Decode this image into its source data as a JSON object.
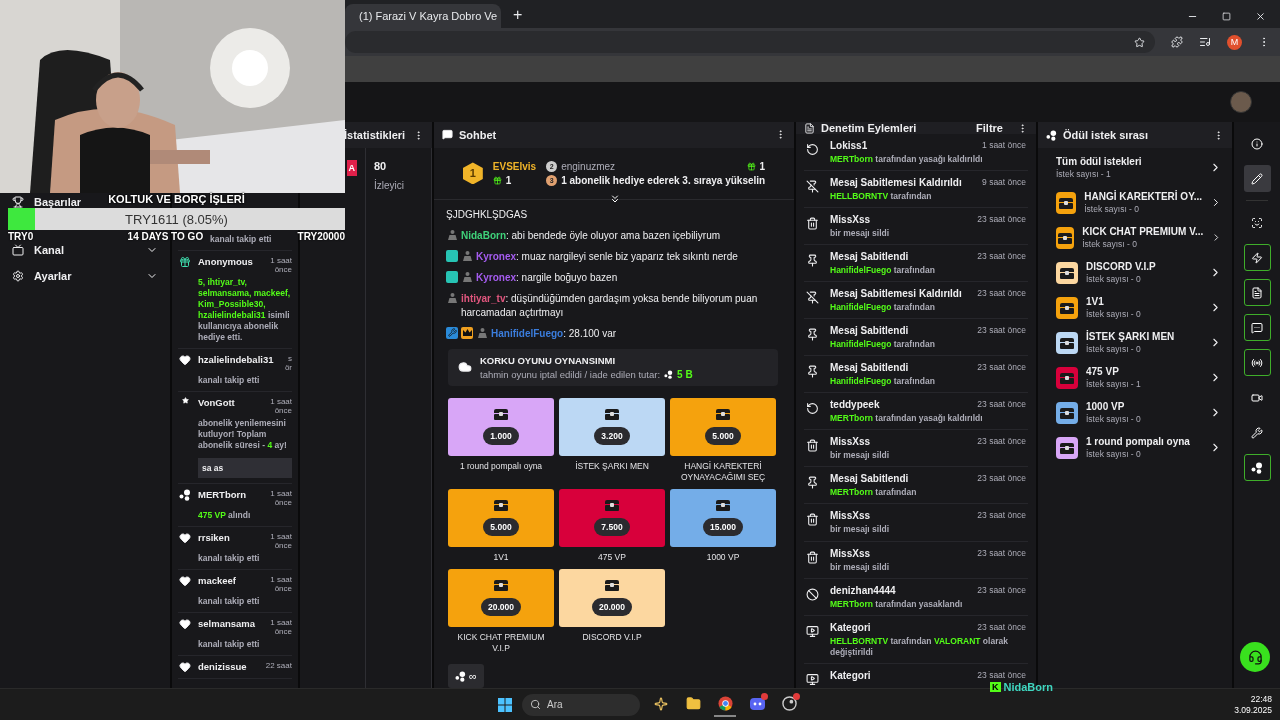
{
  "browser": {
    "tab_title": "(1) Farazi V Kayra Dobro Ve",
    "new_tab": "+",
    "profile_initial": "M"
  },
  "goal": {
    "title": "KOLTUK VE BORÇ İŞLERİ",
    "reading": "TRY1611 (8.05%)",
    "level": 0.0805,
    "start": "TRY0",
    "remaining": "14 DAYS TO GO",
    "target": "TRY20000"
  },
  "sidebar": {
    "items": [
      {
        "label": "Başarılar",
        "kind": "trophy"
      },
      {
        "label": "Kanal",
        "kind": "channel",
        "expanded": false
      },
      {
        "label": "Ayarlar",
        "kind": "settings",
        "expanded": false
      }
    ]
  },
  "activity": {
    "items": [
      {
        "kind": "tail",
        "parts": [
          {
            "text": "kanalı takip etti",
            "highlight": false
          }
        ]
      },
      {
        "kind": "gift",
        "user": "Anonymous",
        "time": "1 saat önce",
        "parts": [
          {
            "text": "5, ihtiyar_tv, selmansama, mackeef, Kim_Possible30, hzalielindebali31",
            "highlight": true
          },
          {
            "text": " isimli kullanıcıya abonelik hediye etti.",
            "highlight": false
          }
        ]
      },
      {
        "kind": "follow",
        "user": "hzalielindebali31",
        "time": "s ör",
        "parts": [
          {
            "text": "kanalı takip etti",
            "highlight": false
          }
        ]
      },
      {
        "kind": "resub",
        "user": "VonGott",
        "time": "1 saat önce",
        "parts": [
          {
            "text": "abonelik yenilemesini kutluyor! Toplam abonelik süresi - ",
            "highlight": false
          },
          {
            "text": "4",
            "highlight": true
          },
          {
            "text": " ay!",
            "highlight": false
          }
        ],
        "message": "sa as"
      },
      {
        "kind": "redeem",
        "user": "MERTborn",
        "time": "1 saat önce",
        "parts": [
          {
            "text": "475 VP",
            "highlight": true
          },
          {
            "text": " alındı",
            "highlight": false
          }
        ]
      },
      {
        "kind": "follow",
        "user": "rrsiken",
        "time": "1 saat önce",
        "parts": [
          {
            "text": "kanalı takip etti",
            "highlight": false
          }
        ]
      },
      {
        "kind": "follow",
        "user": "mackeef",
        "time": "1 saat önce",
        "parts": [
          {
            "text": "kanalı takip etti",
            "highlight": false
          }
        ]
      },
      {
        "kind": "follow",
        "user": "selmansama",
        "time": "1 saat önce",
        "parts": [
          {
            "text": "kanalı takip etti",
            "highlight": false
          }
        ]
      },
      {
        "kind": "follow",
        "user": "denizissue",
        "time": "22 saat"
      }
    ]
  },
  "stats": {
    "title": "İstatistikleri",
    "badge": "A",
    "viewers": "80",
    "viewers_label": "İzleyici"
  },
  "chat": {
    "title": "Sohbet",
    "leaders": [
      {
        "rank": "1",
        "name": "EVSElvis",
        "gifts": "1"
      },
      {
        "rank": "2",
        "name": "enginuzmez",
        "gifts": "1"
      },
      {
        "rank": "3",
        "name": "1 abonelik hediye ederek 3. sıraya yükselin"
      }
    ],
    "messages": [
      {
        "kind": "continuation",
        "text": "ŞJDGHKLŞDGAS"
      },
      {
        "kind": "message",
        "user": "NidaBorn",
        "color": "#3fd27a",
        "badges": [
          {
            "kind": "figure"
          }
        ],
        "text": "abi bendede öyle oluyor ama bazen içebiliyrum"
      },
      {
        "kind": "message",
        "user": "Kyronex",
        "color": "#a55cf0",
        "badges": [
          {
            "kind": "sub"
          },
          {
            "kind": "figure"
          }
        ],
        "text": "muaz nargileyi senle biz yaparız tek sıkıntı nerde"
      },
      {
        "kind": "message",
        "user": "Kyronex",
        "color": "#a55cf0",
        "badges": [
          {
            "kind": "sub"
          },
          {
            "kind": "figure"
          }
        ],
        "text": "nargile boğuyo bazen"
      },
      {
        "kind": "message",
        "user": "ihtiyar_tv",
        "color": "#e0567e",
        "badges": [
          {
            "kind": "figure"
          }
        ],
        "text": "düşündüğümden gardaşım yoksa bende biliyorum puan harcamadan açtırtmayı"
      },
      {
        "kind": "message",
        "user": "HanifidelFuego",
        "color": "#3b7ddd",
        "badges": [
          {
            "kind": "mod"
          },
          {
            "kind": "vip"
          },
          {
            "kind": "figure"
          }
        ],
        "text": "28.100 var"
      }
    ],
    "prediction": {
      "title": "KORKU OYUNU OYNANSINMI",
      "text": "tahmin oyunu iptal edildi / iade edilen tutar:",
      "amount": "5 B"
    },
    "rewards": [
      {
        "title": "1 round pompalı oyna",
        "cost": "1.000",
        "color": "#d8a6f7"
      },
      {
        "title": "İSTEK ŞARKI MEN",
        "cost": "3.200",
        "color": "#bcd8f4"
      },
      {
        "title": "HANGİ KAREKTERİ OYNAYACAĞIMI SEÇ",
        "cost": "5.000",
        "color": "#f5a20d"
      },
      {
        "title": "1V1",
        "cost": "5.000",
        "color": "#f5a20d"
      },
      {
        "title": "475 VP",
        "cost": "7.500",
        "color": "#d8003b"
      },
      {
        "title": "1000 VP",
        "cost": "15.000",
        "color": "#74ade8"
      },
      {
        "title": "KICK CHAT PREMIUM V.I.P",
        "cost": "20.000",
        "color": "#f5a20d"
      },
      {
        "title": "DISCORD V.I.P",
        "cost": "20.000",
        "color": "#fcd7a0"
      }
    ],
    "points_button": "∞",
    "separator": ":"
  },
  "moderation": {
    "title": "Denetim Eylemleri",
    "filter": "Filtre",
    "items": [
      {
        "kind": "unban",
        "title": "Lokiss1",
        "time": "1 saat önce",
        "parts": [
          {
            "text": "MERTborn",
            "highlight": true
          },
          {
            "text": " tarafından yasağı kaldırıldı",
            "highlight": false
          }
        ]
      },
      {
        "kind": "unpin",
        "title": "Mesaj Sabitlemesi Kaldırıldı",
        "time": "9 saat önce",
        "parts": [
          {
            "text": "HELLBORNTV",
            "highlight": true
          },
          {
            "text": " tarafından",
            "highlight": false
          }
        ]
      },
      {
        "kind": "delete",
        "title": "MissXss",
        "time": "23 saat önce",
        "parts": [
          {
            "text": "bir mesajı sildi",
            "highlight": false
          }
        ]
      },
      {
        "kind": "pin",
        "title": "Mesaj Sabitlendi",
        "time": "23 saat önce",
        "parts": [
          {
            "text": "HanifidelFuego",
            "highlight": true
          },
          {
            "text": " tarafından",
            "highlight": false
          }
        ]
      },
      {
        "kind": "unpin",
        "title": "Mesaj Sabitlemesi Kaldırıldı",
        "time": "23 saat önce",
        "parts": [
          {
            "text": "HanifidelFuego",
            "highlight": true
          },
          {
            "text": " tarafından",
            "highlight": false
          }
        ]
      },
      {
        "kind": "pin",
        "title": "Mesaj Sabitlendi",
        "time": "23 saat önce",
        "parts": [
          {
            "text": "HanifidelFuego",
            "highlight": true
          },
          {
            "text": " tarafından",
            "highlight": false
          }
        ]
      },
      {
        "kind": "pin",
        "title": "Mesaj Sabitlendi",
        "time": "23 saat önce",
        "parts": [
          {
            "text": "HanifidelFuego",
            "highlight": true
          },
          {
            "text": " tarafından",
            "highlight": false
          }
        ]
      },
      {
        "kind": "unban",
        "title": "teddypeek",
        "time": "23 saat önce",
        "parts": [
          {
            "text": "MERTborn",
            "highlight": true
          },
          {
            "text": " tarafından yasağı kaldırıldı",
            "highlight": false
          }
        ]
      },
      {
        "kind": "delete",
        "title": "MissXss",
        "time": "23 saat önce",
        "parts": [
          {
            "text": "bir mesajı sildi",
            "highlight": false
          }
        ]
      },
      {
        "kind": "pin",
        "title": "Mesaj Sabitlendi",
        "time": "23 saat önce",
        "parts": [
          {
            "text": "MERTborn",
            "highlight": true
          },
          {
            "text": " tarafından",
            "highlight": false
          }
        ]
      },
      {
        "kind": "delete",
        "title": "MissXss",
        "time": "23 saat önce",
        "parts": [
          {
            "text": "bir mesajı sildi",
            "highlight": false
          }
        ]
      },
      {
        "kind": "delete",
        "title": "MissXss",
        "time": "23 saat önce",
        "parts": [
          {
            "text": "bir mesajı sildi",
            "highlight": false
          }
        ]
      },
      {
        "kind": "ban",
        "title": "denizhan4444",
        "time": "23 saat önce",
        "parts": [
          {
            "text": "MERTborn",
            "highlight": true
          },
          {
            "text": " tarafından yasaklandı",
            "highlight": false
          }
        ]
      },
      {
        "kind": "category",
        "title": "Kategori",
        "time": "23 saat önce",
        "parts": [
          {
            "text": "HELLBORNTV",
            "highlight": true
          },
          {
            "text": " tarafından ",
            "highlight": false
          },
          {
            "text": "VALORANT",
            "highlight": true
          },
          {
            "text": " olarak değiştirildi",
            "highlight": false
          }
        ]
      },
      {
        "kind": "category",
        "title": "Kategori",
        "time": "23 saat önce"
      }
    ]
  },
  "reward_queue": {
    "title": "Ödül istek sırası",
    "all": {
      "title": "Tüm ödül istekleri",
      "count": "İstek sayısı - 1"
    },
    "items": [
      {
        "title": "HANGİ KAREKTERİ OY...",
        "count": "İstek sayısı - 0",
        "color": "#f5a20d"
      },
      {
        "title": "KICK CHAT PREMIUM V...",
        "count": "İstek sayısı - 0",
        "color": "#f5a20d"
      },
      {
        "title": "DISCORD V.I.P",
        "count": "İstek sayısı - 0",
        "color": "#fcd7a0"
      },
      {
        "title": "1V1",
        "count": "İstek sayısı - 0",
        "color": "#f5a20d"
      },
      {
        "title": "İSTEK ŞARKI MEN",
        "count": "İstek sayısı - 0",
        "color": "#bcd8f4"
      },
      {
        "title": "475 VP",
        "count": "İstek sayısı - 1",
        "color": "#d8003b"
      },
      {
        "title": "1000 VP",
        "count": "İstek sayısı - 0",
        "color": "#74ade8"
      },
      {
        "title": "1 round pompalı oyna",
        "count": "İstek sayısı - 0",
        "color": "#d8a6f7"
      }
    ]
  },
  "rail": {
    "items": [
      {
        "kind": "info",
        "selected": false,
        "highlighted": false
      },
      {
        "kind": "edit",
        "selected": true,
        "highlighted": false
      },
      {
        "kind": "divider",
        "selected": false,
        "highlighted": false
      },
      {
        "kind": "camera",
        "selected": false,
        "highlighted": false
      },
      {
        "kind": "bolt",
        "selected": false,
        "highlighted": true
      },
      {
        "kind": "document",
        "selected": false,
        "highlighted": true
      },
      {
        "kind": "chat",
        "selected": false,
        "highlighted": true
      },
      {
        "kind": "broadcast",
        "selected": false,
        "highlighted": true
      },
      {
        "kind": "video",
        "selected": false,
        "highlighted": false
      },
      {
        "kind": "wrench",
        "selected": false,
        "highlighted": false
      },
      {
        "kind": "points",
        "selected": false,
        "highlighted": true
      }
    ]
  },
  "alert": {
    "logo": "K",
    "user": "NidaBorn"
  },
  "taskbar": {
    "search_placeholder": "Ara",
    "time": "22:48",
    "date": "3.09.2025"
  }
}
